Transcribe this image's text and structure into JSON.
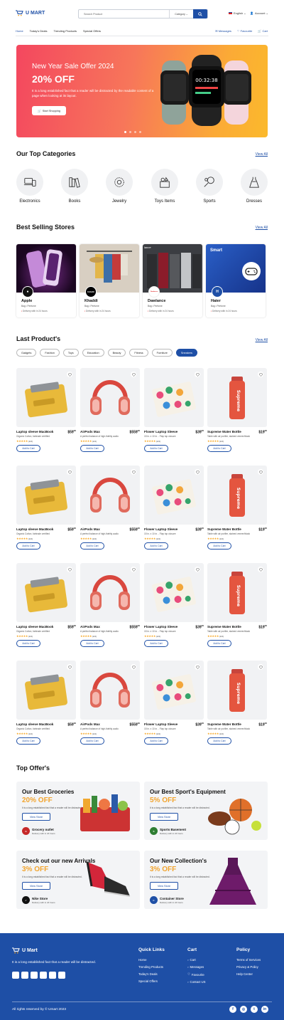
{
  "header": {
    "brand": "U MART",
    "search_placeholder": "Search Product",
    "category_label": "Category",
    "language": "English",
    "account": "Account"
  },
  "nav": {
    "items": [
      "Home",
      "Today's Deals",
      "Trending Products",
      "Special Offers"
    ],
    "right": [
      "Messages",
      "Favourite",
      "Cart"
    ]
  },
  "banner": {
    "title": "New Year Sale Offer 2024",
    "discount": "20% OFF",
    "text": "It is a long established fact that a reader will be distracted by the readable content of a page when looking at its layout.",
    "button": "Start Shopping",
    "watch_time": "00:32:38"
  },
  "categories": {
    "title": "Our Top Categories",
    "view_all": "View All",
    "items": [
      "Electronics",
      "Books",
      "Jewelry",
      "Toys Items",
      "Sports",
      "Dresses"
    ]
  },
  "stores": {
    "title": "Best Selling Stores",
    "view_all": "View All",
    "items": [
      {
        "name": "Apple",
        "sub": "Bag • Perfume",
        "delivery": "Delivery with in 24 hours",
        "badge": ""
      },
      {
        "name": "Khaddi",
        "sub": "Bag • Perfume",
        "delivery": "Delivery with in 24 hours",
        "badge": "KHAADI"
      },
      {
        "name": "Dawlance",
        "sub": "Bag • Perfume",
        "delivery": "Delivery with in 24 hours",
        "badge": "Dawlance"
      },
      {
        "name": "Haier",
        "sub": "Bag • Perfume",
        "delivery": "Delivery with in 24 hours",
        "badge": "H"
      }
    ],
    "dawlance_banner": "lance",
    "haier_banner": "Smart"
  },
  "products": {
    "title": "Last Product's",
    "view_all": "View All",
    "filters": [
      "Gadgets",
      "Fashion",
      "Toys",
      "Education",
      "Beauty",
      "Fitness",
      "Furniture",
      "Sneakers"
    ],
    "selected_filter": "Sneakers",
    "add_to_cart": "Add to Cart",
    "items": [
      {
        "name": "Laptop sleeve MacBook",
        "price": "59",
        "cents": "00",
        "desc": "Organic Cotton, fairtrade certified",
        "reviews": "(121)"
      },
      {
        "name": "AirPods Max",
        "price": "559",
        "cents": "00",
        "desc": "A perfect balance of high-fidelity audio",
        "reviews": "(121)"
      },
      {
        "name": "Flower Laptop Sleeve",
        "price": "39",
        "cents": "00",
        "desc": "15 in. x 10 in. - Flap top closure",
        "reviews": "(121)"
      },
      {
        "name": "Supreme Water Bottle",
        "price": "19",
        "cents": "00",
        "desc": "Table with air purifier, stained veneer/black",
        "reviews": "(121)"
      }
    ]
  },
  "offers": {
    "title": "Top Offer's",
    "items": [
      {
        "title": "Our Best Groceries",
        "pct": "20% OFF",
        "desc": "It is a long established fact that a reader will be distracted.",
        "button": "View Store",
        "brand": "Grocery outlet",
        "delivery": "Delivery with in 24 hours"
      },
      {
        "title": "Our Best Sport's Equipment",
        "pct": "5% OFF",
        "desc": "It is a long established fact that a reader will be distracted.",
        "button": "View Store",
        "brand": "Sports Basement",
        "delivery": "Delivery with in 24 hours"
      },
      {
        "title": "Check out our new Arrivals",
        "pct": "3% OFF",
        "desc": "It is a long established fact that a reader will be distracted.",
        "button": "View Store",
        "brand": "Nike Store",
        "delivery": "Delivery with in 24 hours"
      },
      {
        "title": "Our New Collection's",
        "pct": "3% OFF",
        "desc": "It is a long established fact that a reader will be distracted.",
        "button": "View Store",
        "brand": "Container Store",
        "delivery": "Delivery with in 24 hours"
      }
    ]
  },
  "footer": {
    "brand": "U Mart",
    "tagline": "It is a long established fact that a reader will be distracted.",
    "quick_links_title": "Quick Links",
    "quick_links": [
      "Home",
      "Trending Products",
      "Today's Deals",
      "Special Offers"
    ],
    "cart_title": "Cart",
    "cart_links": [
      "Cart",
      "Messages",
      "Favourite",
      "Contact US"
    ],
    "policy_title": "Policy",
    "policy_links": [
      "Terms of Services",
      "Privacy & Policy",
      "Help Center"
    ],
    "copyright": "All rights reserved by © Umart 2023"
  },
  "colors": {
    "primary": "#1e4fa6",
    "accent": "#f2a530",
    "banner_start": "#f4475f",
    "banner_end": "#fbb92c"
  }
}
